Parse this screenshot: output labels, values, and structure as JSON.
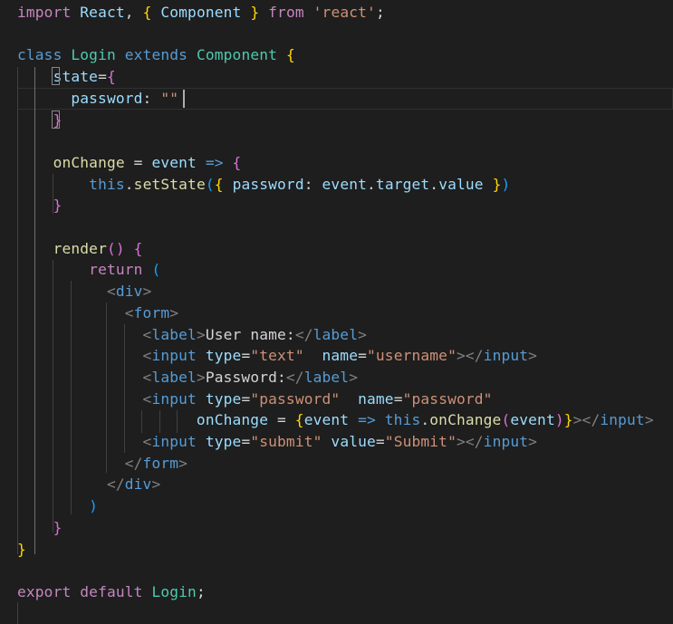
{
  "editor": {
    "language": "javascript-react",
    "theme": "dark",
    "lines": [
      [
        [
          "k",
          "import"
        ],
        [
          "pn",
          " "
        ],
        [
          "vr",
          "React"
        ],
        [
          "pn",
          ", "
        ],
        [
          "b1",
          "{"
        ],
        [
          "pn",
          " "
        ],
        [
          "vr",
          "Component"
        ],
        [
          "pn",
          " "
        ],
        [
          "b1",
          "}"
        ],
        [
          "pn",
          " "
        ],
        [
          "k",
          "from"
        ],
        [
          "pn",
          " "
        ],
        [
          "st",
          "'react'"
        ],
        [
          "pn",
          ";"
        ]
      ],
      [],
      [
        [
          "kb",
          "class"
        ],
        [
          "pn",
          " "
        ],
        [
          "cl",
          "Login"
        ],
        [
          "pn",
          " "
        ],
        [
          "kb",
          "extends"
        ],
        [
          "pn",
          " "
        ],
        [
          "cl",
          "Component"
        ],
        [
          "pn",
          " "
        ],
        [
          "b1",
          "{"
        ]
      ],
      [
        [
          "pn",
          "    "
        ],
        [
          "vr",
          "state"
        ],
        [
          "pn",
          "="
        ],
        [
          "b2",
          "{"
        ]
      ],
      [
        [
          "pn",
          "      "
        ],
        [
          "vr",
          "password"
        ],
        [
          "pn",
          ": "
        ],
        [
          "st",
          "\"\""
        ],
        [
          "pn",
          " "
        ]
      ],
      [
        [
          "pn",
          "    "
        ],
        [
          "b2",
          "}"
        ]
      ],
      [],
      [
        [
          "pn",
          "    "
        ],
        [
          "fn",
          "onChange"
        ],
        [
          "pn",
          " = "
        ],
        [
          "vr",
          "event"
        ],
        [
          "pn",
          " "
        ],
        [
          "kb",
          "=>"
        ],
        [
          "pn",
          " "
        ],
        [
          "b2",
          "{"
        ]
      ],
      [
        [
          "pn",
          "        "
        ],
        [
          "kb",
          "this"
        ],
        [
          "pn",
          "."
        ],
        [
          "fn",
          "setState"
        ],
        [
          "b3",
          "("
        ],
        [
          "b1",
          "{"
        ],
        [
          "pn",
          " "
        ],
        [
          "vr",
          "password"
        ],
        [
          "pn",
          ": "
        ],
        [
          "vr",
          "event"
        ],
        [
          "pn",
          "."
        ],
        [
          "vr",
          "target"
        ],
        [
          "pn",
          "."
        ],
        [
          "vr",
          "value"
        ],
        [
          "pn",
          " "
        ],
        [
          "b1",
          "}"
        ],
        [
          "b3",
          ")"
        ]
      ],
      [
        [
          "pn",
          "    "
        ],
        [
          "b2",
          "}"
        ]
      ],
      [],
      [
        [
          "pn",
          "    "
        ],
        [
          "fn",
          "render"
        ],
        [
          "b2",
          "()"
        ],
        [
          "pn",
          " "
        ],
        [
          "b2",
          "{"
        ]
      ],
      [
        [
          "pn",
          "        "
        ],
        [
          "k",
          "return"
        ],
        [
          "pn",
          " "
        ],
        [
          "b3",
          "("
        ]
      ],
      [
        [
          "pn",
          "          "
        ],
        [
          "pt",
          "<"
        ],
        [
          "tg",
          "div"
        ],
        [
          "pt",
          ">"
        ]
      ],
      [
        [
          "pn",
          "            "
        ],
        [
          "pt",
          "<"
        ],
        [
          "tg",
          "form"
        ],
        [
          "pt",
          ">"
        ]
      ],
      [
        [
          "pn",
          "              "
        ],
        [
          "pt",
          "<"
        ],
        [
          "tg",
          "label"
        ],
        [
          "pt",
          ">"
        ],
        [
          "pn",
          "User name:"
        ],
        [
          "pt",
          "</"
        ],
        [
          "tg",
          "label"
        ],
        [
          "pt",
          ">"
        ]
      ],
      [
        [
          "pn",
          "              "
        ],
        [
          "pt",
          "<"
        ],
        [
          "tg",
          "input"
        ],
        [
          "pn",
          " "
        ],
        [
          "vr",
          "type"
        ],
        [
          "pn",
          "="
        ],
        [
          "st",
          "\"text\""
        ],
        [
          "pn",
          "  "
        ],
        [
          "vr",
          "name"
        ],
        [
          "pn",
          "="
        ],
        [
          "st",
          "\"username\""
        ],
        [
          "pt",
          "></"
        ],
        [
          "tg",
          "input"
        ],
        [
          "pt",
          ">"
        ]
      ],
      [
        [
          "pn",
          "              "
        ],
        [
          "pt",
          "<"
        ],
        [
          "tg",
          "label"
        ],
        [
          "pt",
          ">"
        ],
        [
          "pn",
          "Password:"
        ],
        [
          "pt",
          "</"
        ],
        [
          "tg",
          "label"
        ],
        [
          "pt",
          ">"
        ]
      ],
      [
        [
          "pn",
          "              "
        ],
        [
          "pt",
          "<"
        ],
        [
          "tg",
          "input"
        ],
        [
          "pn",
          " "
        ],
        [
          "vr",
          "type"
        ],
        [
          "pn",
          "="
        ],
        [
          "st",
          "\"password\""
        ],
        [
          "pn",
          "  "
        ],
        [
          "vr",
          "name"
        ],
        [
          "pn",
          "="
        ],
        [
          "st",
          "\"password\""
        ]
      ],
      [
        [
          "pn",
          "                    "
        ],
        [
          "vr",
          "onChange"
        ],
        [
          "pn",
          " = "
        ],
        [
          "b1",
          "{"
        ],
        [
          "vr",
          "event"
        ],
        [
          "pn",
          " "
        ],
        [
          "kb",
          "=>"
        ],
        [
          "pn",
          " "
        ],
        [
          "kb",
          "this"
        ],
        [
          "pn",
          "."
        ],
        [
          "fn",
          "onChange"
        ],
        [
          "b2",
          "("
        ],
        [
          "vr",
          "event"
        ],
        [
          "b2",
          ")"
        ],
        [
          "b1",
          "}"
        ],
        [
          "pt",
          "></"
        ],
        [
          "tg",
          "input"
        ],
        [
          "pt",
          ">"
        ]
      ],
      [
        [
          "pn",
          "              "
        ],
        [
          "pt",
          "<"
        ],
        [
          "tg",
          "input"
        ],
        [
          "pn",
          " "
        ],
        [
          "vr",
          "type"
        ],
        [
          "pn",
          "="
        ],
        [
          "st",
          "\"submit\""
        ],
        [
          "pn",
          " "
        ],
        [
          "vr",
          "value"
        ],
        [
          "pn",
          "="
        ],
        [
          "st",
          "\"Submit\""
        ],
        [
          "pt",
          "></"
        ],
        [
          "tg",
          "input"
        ],
        [
          "pt",
          ">"
        ]
      ],
      [
        [
          "pn",
          "            "
        ],
        [
          "pt",
          "</"
        ],
        [
          "tg",
          "form"
        ],
        [
          "pt",
          ">"
        ]
      ],
      [
        [
          "pn",
          "          "
        ],
        [
          "pt",
          "</"
        ],
        [
          "tg",
          "div"
        ],
        [
          "pt",
          ">"
        ]
      ],
      [
        [
          "pn",
          "        "
        ],
        [
          "b3",
          ")"
        ]
      ],
      [
        [
          "pn",
          "    "
        ],
        [
          "b2",
          "}"
        ]
      ],
      [
        [
          "b1",
          "}"
        ]
      ],
      [],
      [
        [
          "k",
          "export"
        ],
        [
          "pn",
          " "
        ],
        [
          "k",
          "default"
        ],
        [
          "pn",
          " "
        ],
        [
          "cl",
          "Login"
        ],
        [
          "pn",
          ";"
        ]
      ]
    ]
  }
}
